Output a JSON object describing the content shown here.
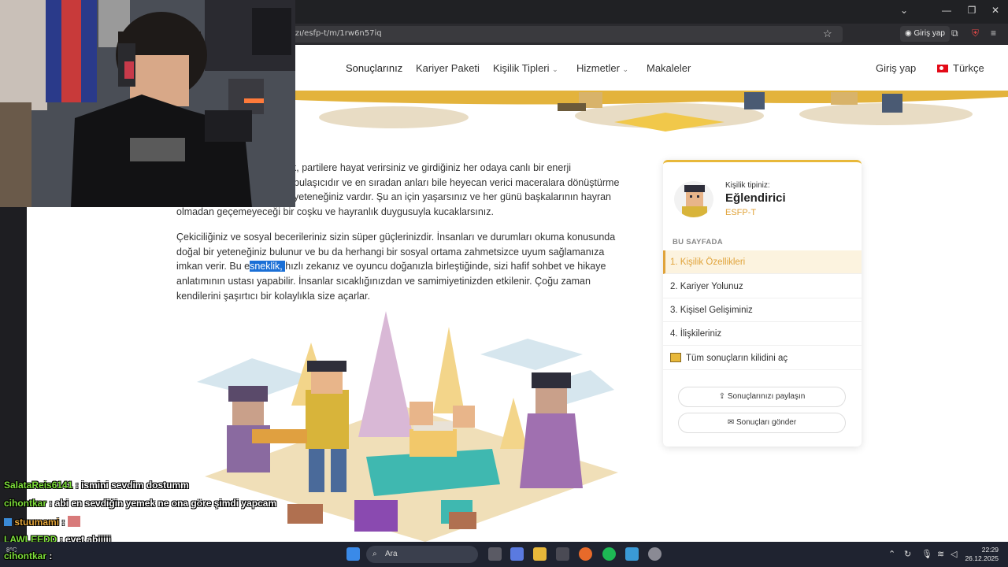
{
  "browser": {
    "url": "ızı/esfp-t/m/1rw6n57iq",
    "signin_label": "Giriş yap"
  },
  "nav": {
    "items": [
      "Sonuçlarınız",
      "Kariyer Paketi",
      "Kişilik Tipleri",
      "Hizmetler",
      "Makaleler"
    ],
    "login": "Giriş yap",
    "language": "Türkçe"
  },
  "article": {
    "p1": [
      "k, partilere hayat verirsiniz ve girdiğiniz her odaya canlı bir enerji",
      "bulaşıcıdır ve en sıradan anları bile heyecan verici maceralara dönüştürme",
      "yeteneğiniz vardır. Şu an için yaşarsınız ve her günü başkalarının hayran",
      "olmadan geçemeyeceği bir coşku ve hayranlık duygusuyla kucaklarsınız."
    ],
    "p2_l1": "Çekiciliğiniz ve sosyal becerileriniz sizin süper güçlerinizdir. İnsanları ve durumları okuma konusunda",
    "p2_l2": "doğal bir yeteneğiniz bulunur ve bu da herhangi bir sosyal ortama zahmetsizce uyum sağlamanıza",
    "p2_l3_a": "imkan verir. Bu e",
    "p2_l3_hl": "sneklik, ",
    "p2_l3_b": "hızlı zekanız ve oyuncu doğanızla birleştiğinde, sizi hafif sohbet ve hikaye",
    "p2_l4": "anlatımının ustası yapabilir. İnsanlar sıcaklığınızdan ve samimiyetinizden etkilenir. Çoğu zaman",
    "p2_l5": "kendilerini şaşırtıcı bir kolaylıkla size açarlar."
  },
  "sidebar": {
    "type_label": "Kişilik tipiniz:",
    "type_name": "Eğlendirici",
    "type_code": "ESFP-T",
    "section_title": "BU SAYFADA",
    "items": [
      "1. Kişilik Özellikleri",
      "2. Kariyer Yolunuz",
      "3. Kişisel Gelişiminiz",
      "4. İlişkileriniz"
    ],
    "unlock": "Tüm sonuçların kilidini aç",
    "share": "Sonuçlarınızı paylaşın",
    "send": "Sonuçları gönder"
  },
  "chat": [
    {
      "user": "SalataReis6141",
      "msg": ": ismini sevdim dostumm",
      "color": "#7dde3a"
    },
    {
      "user": "cihontkar",
      "msg": ": abi en sevdiğin yemek ne ona göre şimdi yapcam",
      "color": "#7dde3a"
    },
    {
      "user": "stuumami",
      "msg": ":",
      "color": "#e8a83a"
    },
    {
      "user": "LAWLEEDD",
      "msg": ": evet abiiiii",
      "color": "#7dde3a"
    },
    {
      "user": "cihontkar",
      "msg": ":",
      "color": "#7dde3a"
    }
  ],
  "taskbar": {
    "search": "Ara",
    "time": "22:29",
    "date": "26.12.2025",
    "weather": "8°C"
  }
}
